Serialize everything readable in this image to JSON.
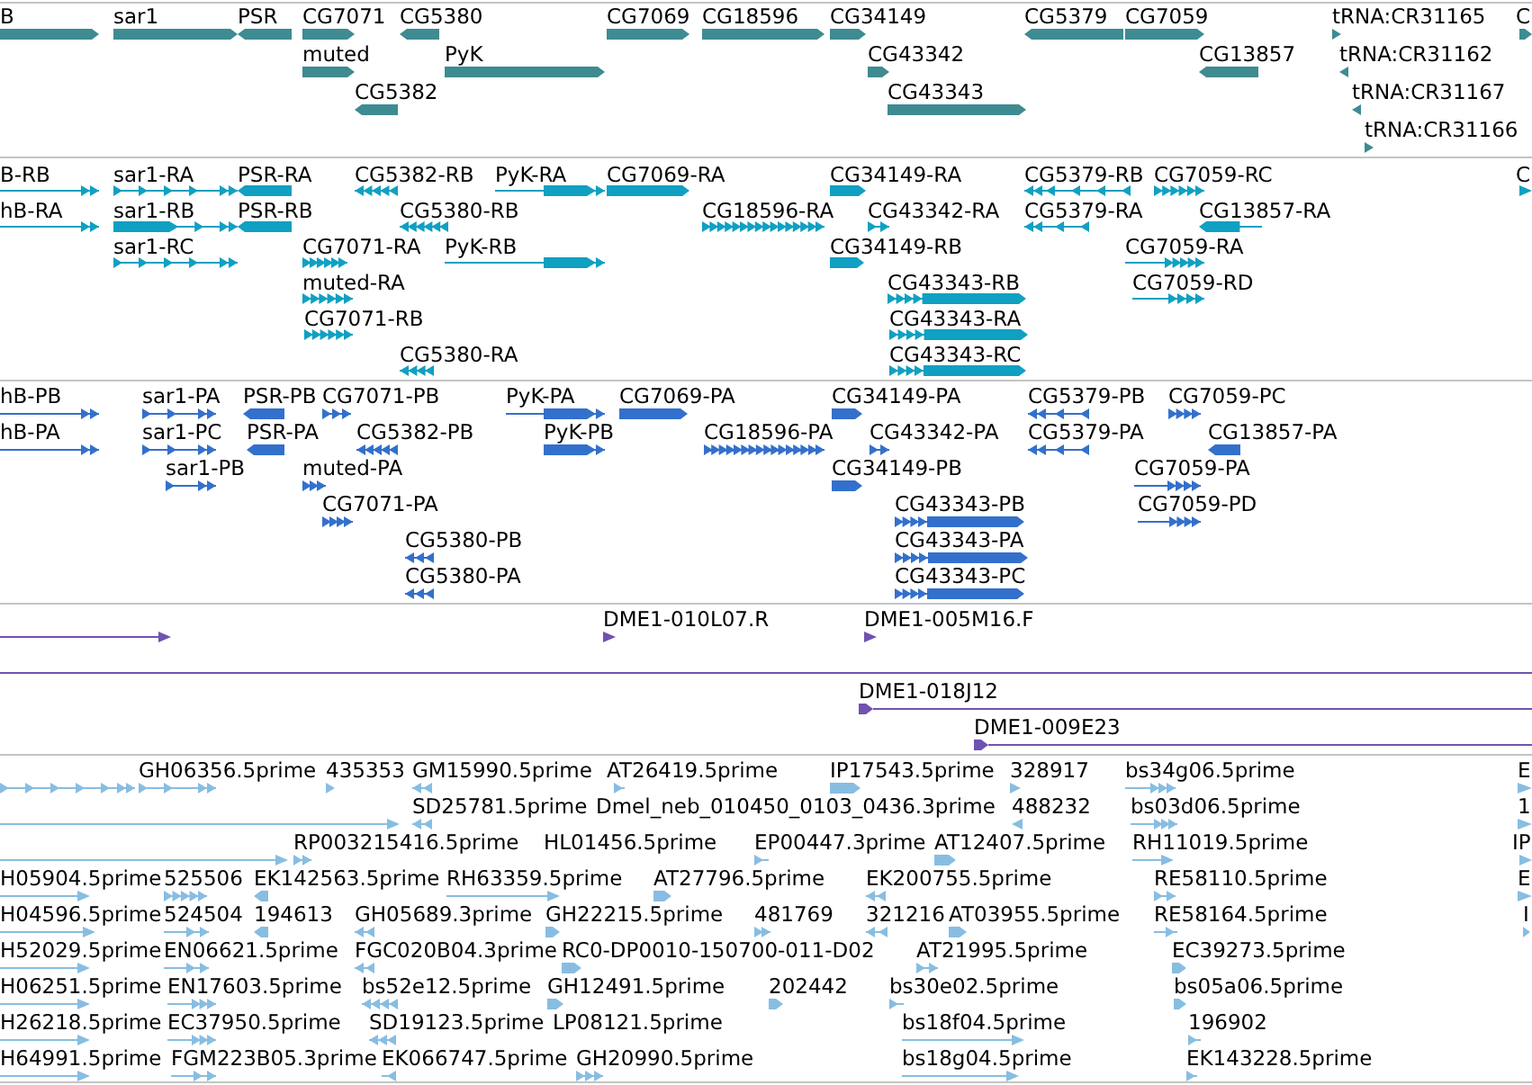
{
  "tracks": [
    {
      "kind": "gene",
      "features": [
        {
          "label": "B",
          "reverse": false
        },
        {
          "label": "sar1",
          "reverse": false
        },
        {
          "label": "PSR",
          "reverse": true
        },
        {
          "label": "CG7071",
          "reverse": false
        },
        {
          "label": "CG5380",
          "reverse": true
        },
        {
          "label": "CG7069",
          "reverse": false
        },
        {
          "label": "CG18596",
          "reverse": false
        },
        {
          "label": "CG34149",
          "reverse": false
        },
        {
          "label": "CG5379",
          "reverse": true
        },
        {
          "label": "CG7059",
          "reverse": false
        },
        {
          "label": "tRNA:CR31165",
          "reverse": false
        },
        {
          "label": "C",
          "reverse": false
        },
        {
          "label": "muted",
          "reverse": false
        },
        {
          "label": "PyK",
          "reverse": false
        },
        {
          "label": "CG43342",
          "reverse": false
        },
        {
          "label": "CG13857",
          "reverse": true
        },
        {
          "label": "tRNA:CR31162",
          "reverse": true
        },
        {
          "label": "CG5382",
          "reverse": true
        },
        {
          "label": "CG43343",
          "reverse": false
        },
        {
          "label": "tRNA:CR31167",
          "reverse": true
        },
        {
          "label": "tRNA:CR31166",
          "reverse": false
        }
      ]
    },
    {
      "kind": "mrna",
      "features": [
        {
          "label": "B-RB",
          "reverse": false
        },
        {
          "label": "sar1-RA",
          "reverse": false
        },
        {
          "label": "PSR-RA",
          "reverse": true
        },
        {
          "label": "CG5382-RB",
          "reverse": true
        },
        {
          "label": "PyK-RA",
          "reverse": false
        },
        {
          "label": "CG7069-RA",
          "reverse": false
        },
        {
          "label": "CG34149-RA",
          "reverse": false
        },
        {
          "label": "CG5379-RB",
          "reverse": true
        },
        {
          "label": "CG7059-RC",
          "reverse": false
        },
        {
          "label": "C",
          "reverse": false
        },
        {
          "label": "hB-RA",
          "reverse": false
        },
        {
          "label": "sar1-RB",
          "reverse": false
        },
        {
          "label": "PSR-RB",
          "reverse": true
        },
        {
          "label": "CG5380-RB",
          "reverse": true
        },
        {
          "label": "CG18596-RA",
          "reverse": false
        },
        {
          "label": "CG43342-RA",
          "reverse": false
        },
        {
          "label": "CG5379-RA",
          "reverse": true
        },
        {
          "label": "CG13857-RA",
          "reverse": true
        },
        {
          "label": "sar1-RC",
          "reverse": false
        },
        {
          "label": "CG7071-RA",
          "reverse": false
        },
        {
          "label": "PyK-RB",
          "reverse": false
        },
        {
          "label": "CG34149-RB",
          "reverse": false
        },
        {
          "label": "CG7059-RA",
          "reverse": false
        },
        {
          "label": "muted-RA",
          "reverse": false
        },
        {
          "label": "CG43343-RB",
          "reverse": false
        },
        {
          "label": "CG7059-RD",
          "reverse": false
        },
        {
          "label": "CG7071-RB",
          "reverse": false
        },
        {
          "label": "CG43343-RA",
          "reverse": false
        },
        {
          "label": "CG5380-RA",
          "reverse": true
        },
        {
          "label": "CG43343-RC",
          "reverse": false
        }
      ]
    },
    {
      "kind": "cds",
      "features": [
        {
          "label": "hB-PB",
          "reverse": false
        },
        {
          "label": "sar1-PA",
          "reverse": false
        },
        {
          "label": "PSR-PB",
          "reverse": true
        },
        {
          "label": "CG7071-PB",
          "reverse": false
        },
        {
          "label": "PyK-PA",
          "reverse": false
        },
        {
          "label": "CG7069-PA",
          "reverse": false
        },
        {
          "label": "CG34149-PA",
          "reverse": false
        },
        {
          "label": "CG5379-PB",
          "reverse": true
        },
        {
          "label": "CG7059-PC",
          "reverse": false
        },
        {
          "label": "hB-PA",
          "reverse": false
        },
        {
          "label": "sar1-PC",
          "reverse": false
        },
        {
          "label": "PSR-PA",
          "reverse": true
        },
        {
          "label": "CG5382-PB",
          "reverse": true
        },
        {
          "label": "PyK-PB",
          "reverse": false
        },
        {
          "label": "CG18596-PA",
          "reverse": false
        },
        {
          "label": "CG43342-PA",
          "reverse": false
        },
        {
          "label": "CG5379-PA",
          "reverse": true
        },
        {
          "label": "CG13857-PA",
          "reverse": true
        },
        {
          "label": "sar1-PB",
          "reverse": false
        },
        {
          "label": "muted-PA",
          "reverse": false
        },
        {
          "label": "CG34149-PB",
          "reverse": false
        },
        {
          "label": "CG7059-PA",
          "reverse": false
        },
        {
          "label": "CG7071-PA",
          "reverse": false
        },
        {
          "label": "CG43343-PB",
          "reverse": false
        },
        {
          "label": "CG7059-PD",
          "reverse": false
        },
        {
          "label": "CG5380-PB",
          "reverse": true
        },
        {
          "label": "CG43343-PA",
          "reverse": false
        },
        {
          "label": "CG5380-PA",
          "reverse": true
        },
        {
          "label": "CG43343-PC",
          "reverse": false
        }
      ]
    },
    {
      "kind": "clone",
      "features": [
        {
          "reverse": false,
          "clipped": false
        },
        {
          "label": "DME1-010L07.R",
          "reverse": false,
          "clipped": false
        },
        {
          "label": "DME1-005M16.F",
          "reverse": false,
          "clipped": false
        },
        {
          "clipped": true
        },
        {
          "label": "DME1-018J12",
          "reverse": false,
          "clipped": false
        },
        {
          "label": "DME1-009E23",
          "reverse": false,
          "clipped": false
        }
      ]
    },
    {
      "kind": "est",
      "features": [
        {
          "reverse": false
        },
        {
          "label": "GH06356.5prime",
          "reverse": false
        },
        {
          "label": "435353",
          "reverse": false
        },
        {
          "label": "GM15990.5prime",
          "reverse": true
        },
        {
          "label": "AT26419.5prime",
          "reverse": false
        },
        {
          "label": "IP17543.5prime",
          "reverse": false
        },
        {
          "label": "328917",
          "reverse": false
        },
        {
          "label": "bs34g06.5prime",
          "reverse": false
        },
        {
          "label": "E",
          "reverse": false
        },
        {
          "reverse": false
        },
        {
          "label": "SD25781.5prime",
          "reverse": true
        },
        {
          "label": "Dmel_neb_010450_0103_0436.3prime"
        },
        {
          "label": "488232",
          "reverse": true
        },
        {
          "label": "bs03d06.5prime",
          "reverse": false
        },
        {
          "label": "1",
          "reverse": false
        },
        {
          "reverse": false
        },
        {
          "label": "RP003215416.5prime",
          "reverse": false
        },
        {
          "label": "HL01456.5prime"
        },
        {
          "label": "EP00447.3prime",
          "reverse": false
        },
        {
          "label": "AT12407.5prime",
          "reverse": false
        },
        {
          "label": "RH11019.5prime",
          "reverse": false
        },
        {
          "label": "IP",
          "reverse": false
        },
        {
          "label": "H05904.5prime",
          "reverse": false
        },
        {
          "label": "525506",
          "reverse": false
        },
        {
          "label": "EK142563.5prime",
          "reverse": true
        },
        {
          "label": "RH63359.5prime",
          "reverse": false
        },
        {
          "label": "AT27796.5prime",
          "reverse": false
        },
        {
          "label": "EK200755.5prime",
          "reverse": true
        },
        {
          "label": "RE58110.5prime",
          "reverse": false
        },
        {
          "label": "E",
          "reverse": false
        },
        {
          "label": "H04596.5prime",
          "reverse": false
        },
        {
          "label": "524504",
          "reverse": false
        },
        {
          "label": "194613",
          "reverse": true
        },
        {
          "label": "GH05689.3prime",
          "reverse": true
        },
        {
          "label": "GH22215.5prime",
          "reverse": false
        },
        {
          "label": "481769",
          "reverse": false
        },
        {
          "label": "321216",
          "reverse": true
        },
        {
          "label": "AT03955.5prime",
          "reverse": false
        },
        {
          "label": "RE58164.5prime",
          "reverse": false
        },
        {
          "label": "I",
          "reverse": false
        },
        {
          "label": "H52029.5prime",
          "reverse": false
        },
        {
          "label": "EN06621.5prime",
          "reverse": false
        },
        {
          "label": "FGC020B04.3prime",
          "reverse": true
        },
        {
          "label": "RC0-DP0010-150700-011-D02",
          "reverse": false
        },
        {
          "label": "AT21995.5prime",
          "reverse": false
        },
        {
          "label": "EC39273.5prime",
          "reverse": false
        },
        {
          "label": "H06251.5prime",
          "reverse": false
        },
        {
          "label": "EN17603.5prime",
          "reverse": false
        },
        {
          "label": "bs52e12.5prime",
          "reverse": true
        },
        {
          "label": "GH12491.5prime",
          "reverse": false
        },
        {
          "label": "202442",
          "reverse": false
        },
        {
          "label": "bs30e02.5prime",
          "reverse": false
        },
        {
          "label": "bs05a06.5prime",
          "reverse": false
        },
        {
          "label": "H26218.5prime",
          "reverse": false
        },
        {
          "label": "EC37950.5prime",
          "reverse": false
        },
        {
          "label": "SD19123.5prime",
          "reverse": true
        },
        {
          "label": "LP08121.5prime"
        },
        {
          "label": "bs18f04.5prime",
          "reverse": false
        },
        {
          "label": "196902",
          "reverse": false
        },
        {
          "label": "H64991.5prime",
          "reverse": false
        },
        {
          "label": "FGM223B05.3prime",
          "reverse": false
        },
        {
          "label": "EK066747.5prime",
          "reverse": true
        },
        {
          "label": "GH20990.5prime",
          "reverse": false
        },
        {
          "label": "bs18g04.5prime",
          "reverse": false
        },
        {
          "label": "EK143228.5prime",
          "reverse": false
        }
      ]
    }
  ]
}
